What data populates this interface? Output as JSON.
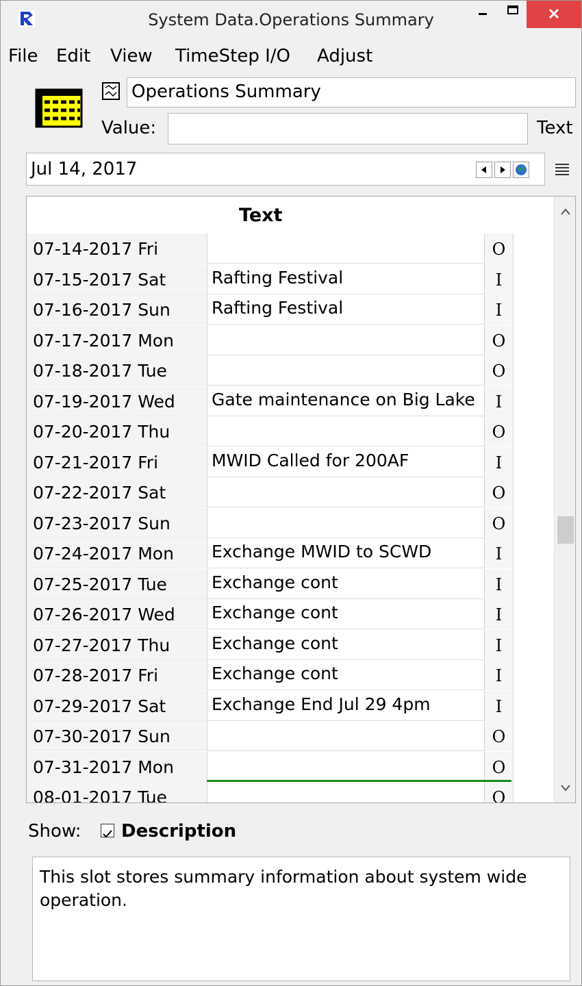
{
  "window": {
    "title": "System Data.Operations Summary"
  },
  "menu": [
    "File",
    "Edit",
    "View",
    "TimeStep I/O",
    "Adjust"
  ],
  "slot": {
    "name": "Operations Summary",
    "value_label": "Value:",
    "value": "",
    "units": "Text"
  },
  "date": {
    "current": "Jul 14, 2017"
  },
  "table": {
    "column_header": "Text",
    "rows": [
      {
        "date": "07-14-2017 Fri",
        "text": "",
        "flag": "O"
      },
      {
        "date": "07-15-2017 Sat",
        "text": "Rafting Festival",
        "flag": "I"
      },
      {
        "date": "07-16-2017 Sun",
        "text": "Rafting Festival",
        "flag": "I"
      },
      {
        "date": "07-17-2017 Mon",
        "text": "",
        "flag": "O"
      },
      {
        "date": "07-18-2017 Tue",
        "text": "",
        "flag": "O"
      },
      {
        "date": "07-19-2017 Wed",
        "text": "Gate maintenance on Big Lake",
        "flag": "I"
      },
      {
        "date": "07-20-2017 Thu",
        "text": "",
        "flag": "O"
      },
      {
        "date": "07-21-2017 Fri",
        "text": "MWID Called for 200AF",
        "flag": "I"
      },
      {
        "date": "07-22-2017 Sat",
        "text": "",
        "flag": "O"
      },
      {
        "date": "07-23-2017 Sun",
        "text": "",
        "flag": "O"
      },
      {
        "date": "07-24-2017 Mon",
        "text": "Exchange MWID to SCWD",
        "flag": "I"
      },
      {
        "date": "07-25-2017 Tue",
        "text": "Exchange cont",
        "flag": "I"
      },
      {
        "date": "07-26-2017 Wed",
        "text": "Exchange cont",
        "flag": "I"
      },
      {
        "date": "07-27-2017 Thu",
        "text": "Exchange cont",
        "flag": "I"
      },
      {
        "date": "07-28-2017 Fri",
        "text": "Exchange cont",
        "flag": "I"
      },
      {
        "date": "07-29-2017 Sat",
        "text": "Exchange End Jul 29 4pm",
        "flag": "I"
      },
      {
        "date": "07-30-2017 Sun",
        "text": "",
        "flag": "O"
      },
      {
        "date": "07-31-2017 Mon",
        "text": "",
        "flag": "O"
      },
      {
        "date": "08-01-2017 Tue",
        "text": "",
        "flag": "O"
      }
    ]
  },
  "show": {
    "label": "Show:",
    "description_label": "Description",
    "description_checked": true
  },
  "description": "This slot stores summary information about system wide operation.",
  "colors": {
    "close_button": "#e04343",
    "end_line": "#1a8a1a",
    "app_icon": "#1f3fbf"
  },
  "icons": {
    "app": "riverware-logo-icon",
    "slot": "table-slot-icon",
    "graph": "graph-icon",
    "prev": "prev-date-icon",
    "next": "next-date-icon",
    "globe": "globe-icon",
    "list": "list-icon"
  }
}
